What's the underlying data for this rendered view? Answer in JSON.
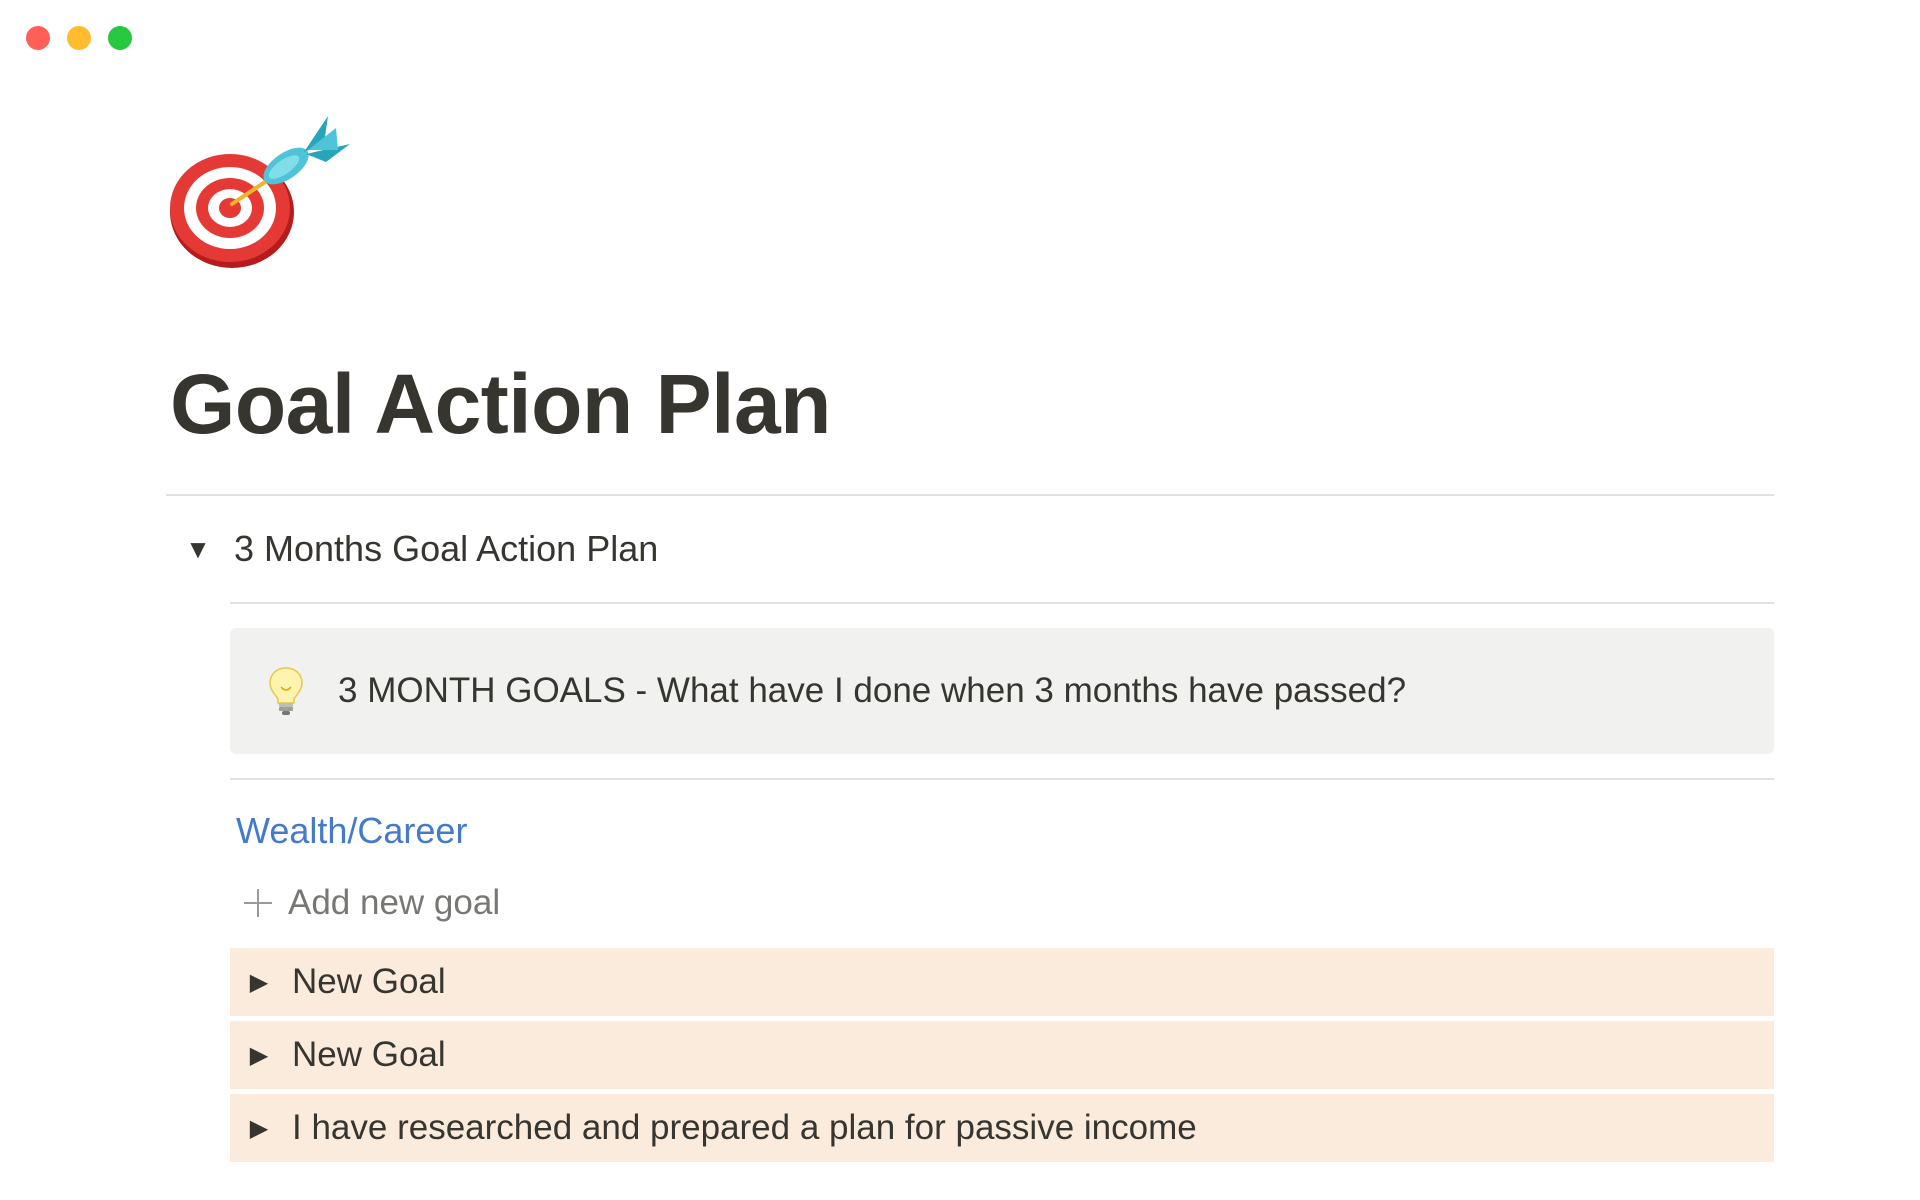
{
  "window": {
    "controls": [
      {
        "name": "close",
        "color": "#ff5f57"
      },
      {
        "name": "minimize",
        "color": "#febc2e"
      },
      {
        "name": "zoom",
        "color": "#28c840"
      }
    ]
  },
  "page": {
    "icon": "target-dart-icon",
    "title": "Goal Action Plan"
  },
  "toggle": {
    "icon": "triangle-down-icon",
    "title": "3 Months Goal Action Plan",
    "expanded": true
  },
  "callout": {
    "icon": "lightbulb-icon",
    "text": "3 MONTH GOALS - What have I done when 3 months have passed?",
    "background": "#f1f1ef"
  },
  "section": {
    "title": "Wealth/Career",
    "color": "#447acb"
  },
  "add_goal": {
    "icon": "plus-icon",
    "label": "Add new goal"
  },
  "goals": [
    {
      "label": "New Goal",
      "icon": "triangle-right-icon"
    },
    {
      "label": "New Goal",
      "icon": "triangle-right-icon"
    },
    {
      "label": "I have researched and prepared a plan for passive income",
      "icon": "triangle-right-icon"
    }
  ],
  "colors": {
    "goal_row_bg": "#faebdd",
    "text": "#37352f"
  }
}
